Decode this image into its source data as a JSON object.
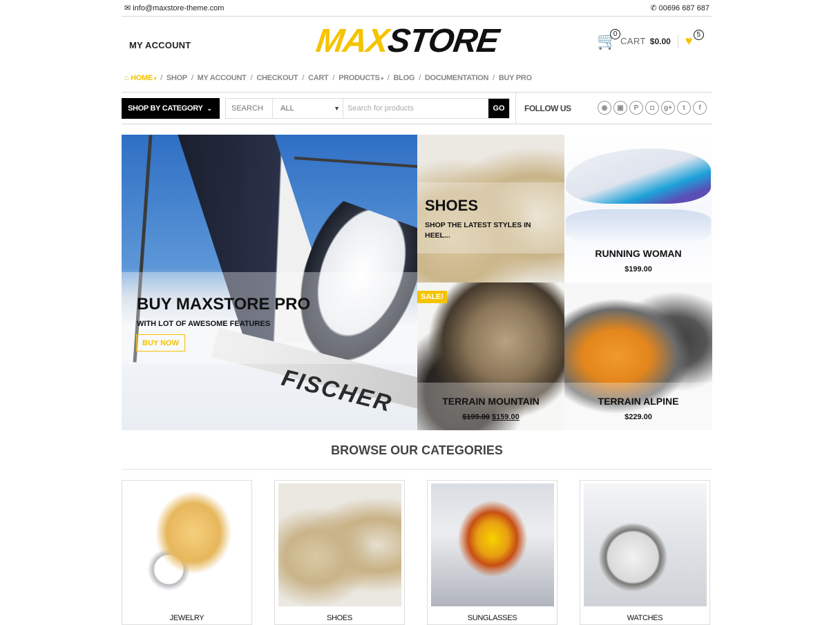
{
  "topbar": {
    "email_icon": "envelope-icon",
    "email": "info@maxstore-theme.com",
    "phone_icon": "phone-icon",
    "phone": "00696 687 687"
  },
  "header": {
    "my_account": "MY ACCOUNT",
    "logo_max": "MAX",
    "logo_store": "STORE",
    "cart_icon": "shopping-cart-icon",
    "cart_count": "0",
    "cart_label": "CART",
    "cart_total": "$0.00",
    "wishlist_icon": "heart-icon",
    "wishlist_count": "5"
  },
  "nav": {
    "items": [
      {
        "label": "HOME",
        "has_dropdown": true,
        "active": true
      },
      {
        "label": "SHOP"
      },
      {
        "label": "MY ACCOUNT"
      },
      {
        "label": "CHECKOUT"
      },
      {
        "label": "CART"
      },
      {
        "label": "PRODUCTS",
        "has_dropdown": true
      },
      {
        "label": "BLOG"
      },
      {
        "label": "DOCUMENTATION"
      },
      {
        "label": "BUY PRO"
      }
    ],
    "separator": "/",
    "home_icon": "⌂",
    "caret": "▾"
  },
  "search": {
    "category_button": "SHOP BY CATEGORY",
    "chevron": "⌄",
    "label": "SEARCH",
    "selected_category": "ALL",
    "select_arrow": "▼",
    "placeholder": "Search for products",
    "value": "",
    "go_label": "GO"
  },
  "follow": {
    "label": "FOLLOW US",
    "icons": [
      {
        "name": "reddit-icon",
        "glyph": "◉"
      },
      {
        "name": "youtube-icon",
        "glyph": "▣"
      },
      {
        "name": "pinterest-icon",
        "glyph": "P"
      },
      {
        "name": "instagram-icon",
        "glyph": "◘"
      },
      {
        "name": "google-plus-icon",
        "glyph": "g+"
      },
      {
        "name": "twitter-icon",
        "glyph": "t"
      },
      {
        "name": "facebook-icon",
        "glyph": "f"
      }
    ]
  },
  "hero": {
    "main": {
      "title": "BUY MAXSTORE PRO",
      "subtitle": "WITH LOT OF AWESOME FEATURES",
      "button": "BUY NOW",
      "ski_brand": "FISCHER"
    },
    "shoes": {
      "title": "SHOES",
      "subtitle": "SHOP THE LATEST STYLES IN HEEL..."
    },
    "products": [
      {
        "title": "RUNNING WOMAN",
        "price": "$199.00"
      },
      {
        "title": "TERRAIN MOUNTAIN",
        "old_price": "$199.00",
        "price": "$159.00",
        "badge": "SALE!"
      },
      {
        "title": "TERRAIN ALPINE",
        "price": "$229.00"
      }
    ]
  },
  "categories": {
    "heading": "BROWSE OUR CATEGORIES",
    "items": [
      {
        "name": "JEWELRY"
      },
      {
        "name": "SHOES"
      },
      {
        "name": "SUNGLASSES"
      },
      {
        "name": "WATCHES"
      }
    ]
  },
  "colors": {
    "accent": "#f5c300",
    "dark": "#000000",
    "nav_text": "#888888"
  }
}
